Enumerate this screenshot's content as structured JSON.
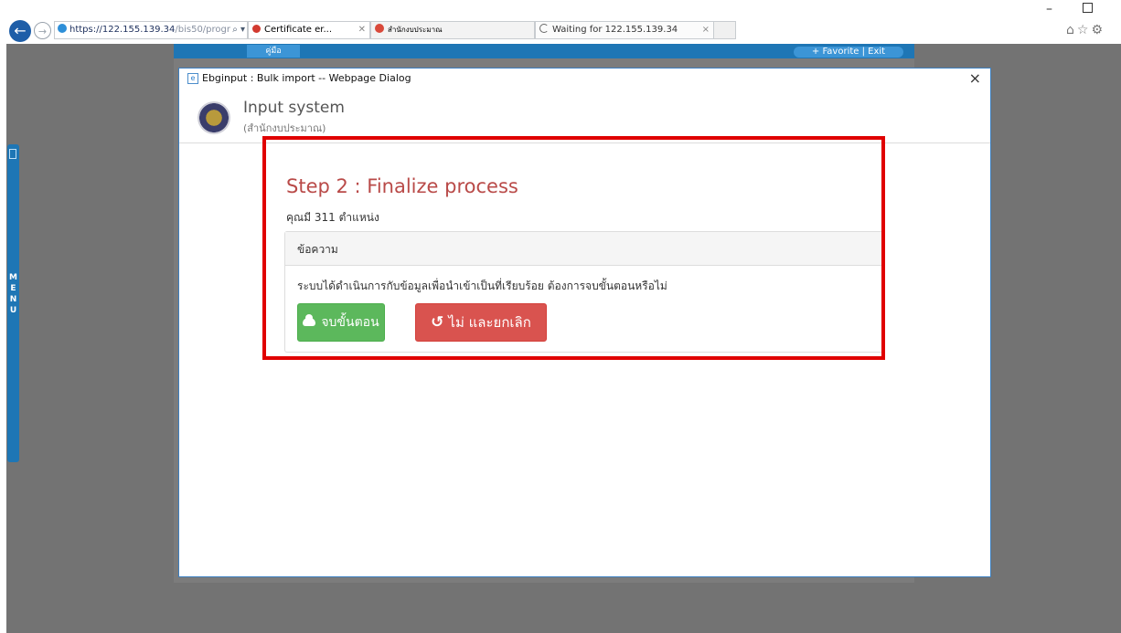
{
  "browser": {
    "url_dark": "https://122.155.139.34",
    "url_light": "/bis50/progr",
    "url_controls": "⌕ ▾",
    "tabs": [
      {
        "label": "Certificate er...",
        "close": "✕"
      },
      {
        "label": "สำนักงบประมาณ",
        "close": ""
      },
      {
        "label": "Waiting for 122.155.139.34",
        "close": "×"
      }
    ],
    "toolbar_icons": "⌂☆⚙",
    "minimize_glyph": "–"
  },
  "page": {
    "manual_label": "คู่มือ",
    "favorite_exit": "+ Favorite | Exit",
    "side_menu_label": "M\nE\nN\nU"
  },
  "dialog": {
    "window_title": "Ebginput : Bulk import -- Webpage Dialog",
    "close_glyph": "×",
    "system_title": "Input system",
    "system_subtitle": "(สำนักงบประมาณ)",
    "step_title": "Step 2 : Finalize process",
    "step_subtitle": "คุณมี 311 ตำแหน่ง",
    "panel_heading": "ข้อความ",
    "panel_message": "ระบบได้ดำเนินการกับข้อมูลเพื่อนำเข้าเป็นที่เรียบร้อย ต้องการจบขั้นตอนหรือไม่",
    "confirm_button": "จบขั้นตอน",
    "cancel_button": "ไม่ และยกเลิก",
    "cancel_icon_glyph": "↺"
  },
  "colors": {
    "highlight": "#e00000",
    "success": "#5cb85c",
    "danger": "#d9534f",
    "step_title": "#b94a48",
    "browser_accent": "#1e76b5"
  }
}
